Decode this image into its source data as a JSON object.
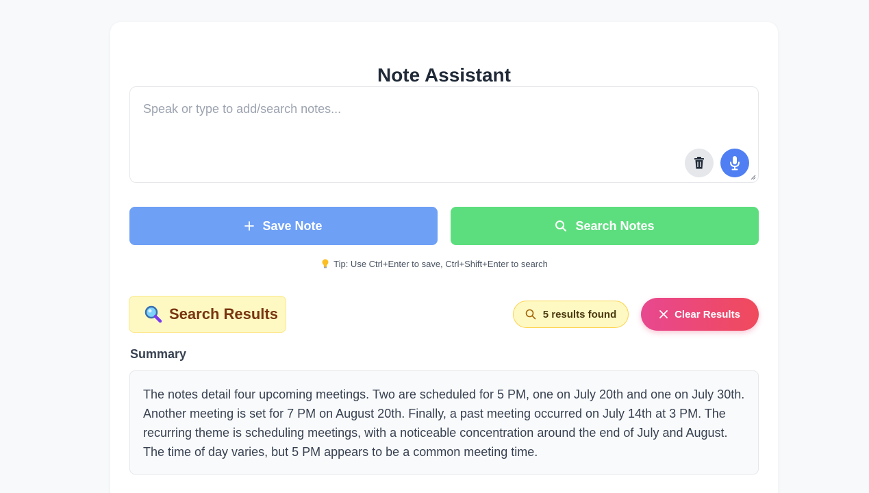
{
  "app": {
    "title": "Note Assistant"
  },
  "input": {
    "placeholder": "Speak or type to add/search notes...",
    "value": ""
  },
  "icons": {
    "trash": "trash-icon",
    "mic": "microphone-icon",
    "plus": "plus-icon",
    "search": "search-icon",
    "bulb": "lightbulb-icon",
    "magnifier": "magnifier-emoji-icon",
    "close": "close-icon"
  },
  "actions": {
    "save_label": "Save Note",
    "search_label": "Search Notes"
  },
  "tip": {
    "text": "Tip: Use Ctrl+Enter to save, Ctrl+Shift+Enter to search"
  },
  "results": {
    "title": "Search Results",
    "count_text": "5 results found",
    "clear_label": "Clear Results",
    "summary_label": "Summary",
    "summary_text": "The notes detail four upcoming meetings. Two are scheduled for 5 PM, one on July 20th and one on July 30th. Another meeting is set for 7 PM on August 20th. Finally, a past meeting occurred on July 14th at 3 PM. The recurring theme is scheduling meetings, with a noticeable concentration around the end of July and August. The time of day varies, but 5 PM appears to be a common meeting time."
  },
  "colors": {
    "save": "#6ea0f6",
    "search": "#5dde7e",
    "mic": "#4f7ff2",
    "badge_bg": "#fef9c3",
    "clear_start": "#e8488f",
    "clear_end": "#f04a5c"
  }
}
